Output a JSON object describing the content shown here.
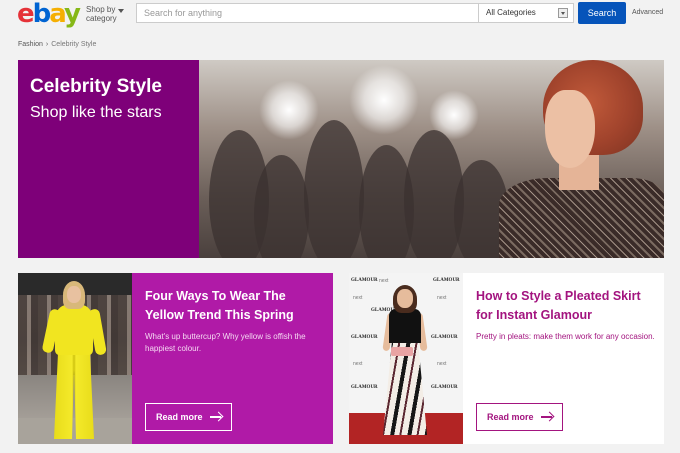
{
  "header": {
    "logo_letters": [
      "e",
      "b",
      "a",
      "y"
    ],
    "shop_by_category": "Shop by category",
    "search_placeholder": "Search for anything",
    "category_selected": "All Categories",
    "search_button": "Search",
    "advanced_link": "Advanced"
  },
  "breadcrumb": {
    "items": [
      "Fashion",
      "Celebrity Style"
    ],
    "separator": "›"
  },
  "hero": {
    "title": "Celebrity Style",
    "subtitle": "Shop like the stars",
    "panel_color": "#7e0079"
  },
  "cards": [
    {
      "title": "Four Ways To Wear The Yellow Trend This Spring",
      "description": "What's up buttercup? Why yellow is offish the happiest colour.",
      "button": "Read more",
      "color": "#b01aa7"
    },
    {
      "title": "How to Style a Pleated Skirt for Instant Glamour",
      "description": "Pretty in pleats: make them work for any occasion.",
      "button": "Read more",
      "color": "#a3147f"
    }
  ],
  "photo_backdrop_text": {
    "glamour": "GLAMOUR",
    "next": "next"
  },
  "colors": {
    "search_button": "#0654ba",
    "page_background": "#f2f2f2"
  }
}
